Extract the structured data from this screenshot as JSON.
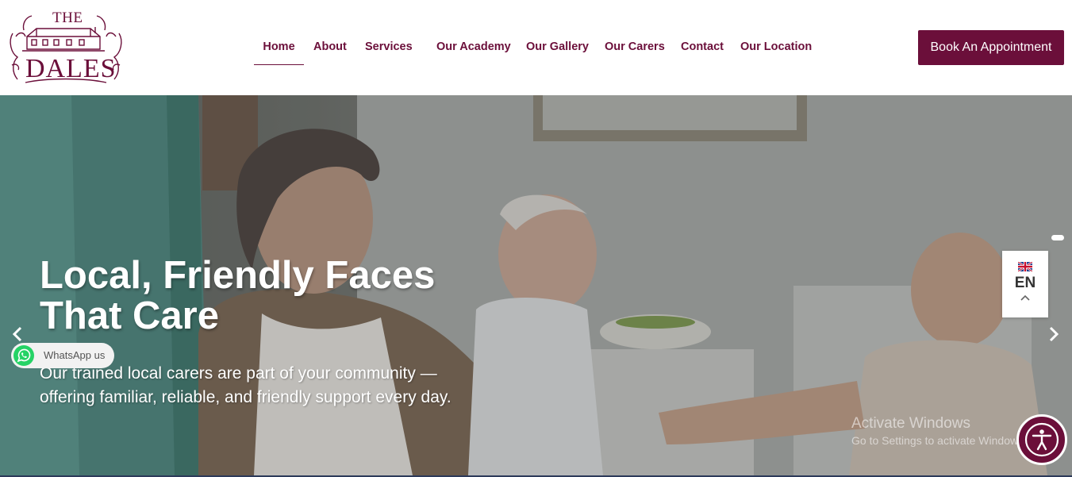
{
  "header": {
    "logo_top": "THE",
    "logo_main": "DALES",
    "nav": [
      {
        "label": "Home"
      },
      {
        "label": "About"
      },
      {
        "label": "Services"
      },
      {
        "label": "Our Academy"
      },
      {
        "label": "Our Gallery"
      },
      {
        "label": "Our Carers"
      },
      {
        "label": "Contact"
      },
      {
        "label": "Our Location"
      }
    ],
    "active_nav": "Home",
    "cta_label": "Book An Appointment"
  },
  "hero": {
    "title_line1": "Local, Friendly Faces",
    "title_line2": "That Care",
    "subtitle_line1": "Our trained local carers are part of your community —",
    "subtitle_line2": "offering familiar, reliable, and friendly support every day.",
    "prev_icon": "chevron-left-icon",
    "next_icon": "chevron-right-icon"
  },
  "language": {
    "code": "EN",
    "flag": "uk-flag-icon"
  },
  "whatsapp": {
    "label": "WhatsApp us"
  },
  "watermark": {
    "title": "Activate Windows",
    "subtitle": "Go to Settings to activate Windows."
  },
  "colors": {
    "brand": "#6b0f3a",
    "white": "#ffffff"
  }
}
